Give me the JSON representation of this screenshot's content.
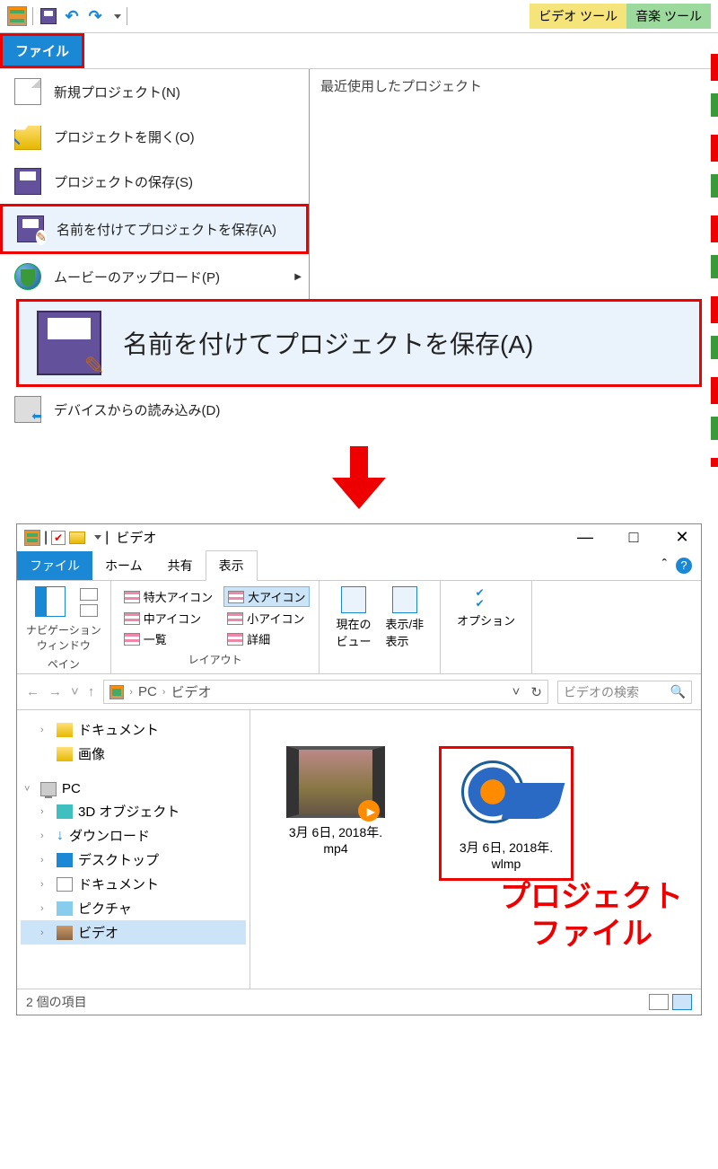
{
  "moviemaker": {
    "tool_tabs": {
      "video": "ビデオ ツール",
      "music": "音楽 ツール"
    },
    "file_tab": "ファイル",
    "recent_header": "最近使用したプロジェクト",
    "menu": {
      "new_project": "新規プロジェクト(N)",
      "open_project": "プロジェクトを開く(O)",
      "save_project": "プロジェクトの保存(S)",
      "save_project_as": "名前を付けてプロジェクトを保存(A)",
      "upload_movie": "ムービーのアップロード(P)",
      "import_device": "デバイスからの読み込み(D)"
    },
    "callout": "名前を付けてプロジェクトを保存(A)"
  },
  "explorer": {
    "title": "ビデオ",
    "tabs": {
      "file": "ファイル",
      "home": "ホーム",
      "share": "共有",
      "view": "表示"
    },
    "ribbon": {
      "nav_pane": "ナビゲーション\nウィンドウ",
      "pane_group": "ペイン",
      "layout": {
        "extra_large": "特大アイコン",
        "large": "大アイコン",
        "medium": "中アイコン",
        "small": "小アイコン",
        "list": "一覧",
        "details": "詳細",
        "group": "レイアウト"
      },
      "current_view": "現在の\nビュー",
      "show_hide": "表示/非\n表示",
      "options": "オプション"
    },
    "breadcrumbs": [
      "PC",
      "ビデオ"
    ],
    "search_placeholder": "ビデオの検索",
    "tree": {
      "documents": "ドキュメント",
      "pictures": "画像",
      "pc": "PC",
      "objects3d": "3D オブジェクト",
      "downloads": "ダウンロード",
      "desktop": "デスクトップ",
      "documents2": "ドキュメント",
      "pictures2": "ピクチャ",
      "videos": "ビデオ"
    },
    "files": {
      "mp4": "3月 6日, 2018年.\nmp4",
      "wlmp": "3月 6日, 2018年.\nwlmp"
    },
    "status": "2 個の項目",
    "annotation": "プロジェクト\nファイル"
  }
}
